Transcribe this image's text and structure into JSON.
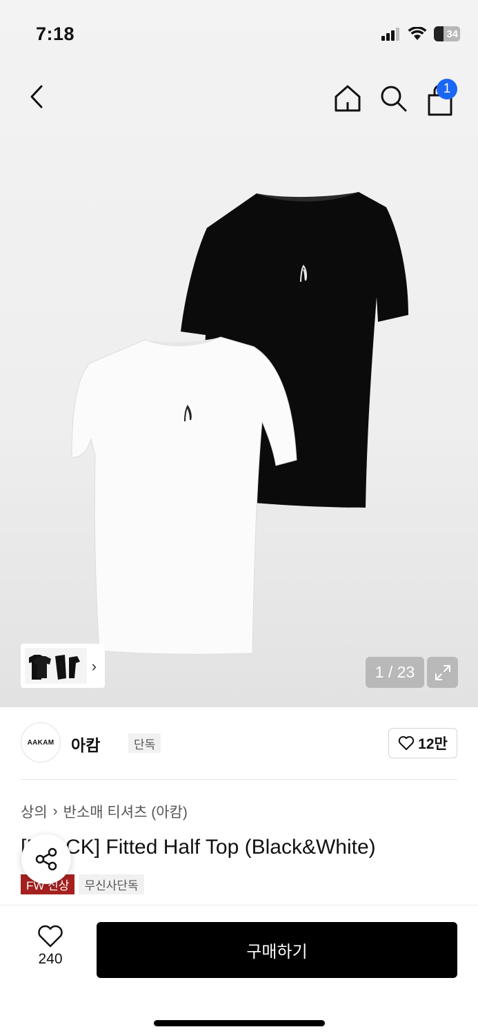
{
  "status_bar": {
    "time": "7:18",
    "battery": "34"
  },
  "nav": {
    "cart_count": "1"
  },
  "gallery": {
    "counter": "1 / 23"
  },
  "brand": {
    "logo_text": "AAKAM",
    "name": "아캄",
    "tag": "단독",
    "likes": "12만"
  },
  "breadcrumb": {
    "category": "상의",
    "subcategory": "반소매 티셔츠 (아캄)"
  },
  "product": {
    "title": "[BLACK] Fitted Half Top (Black&White)",
    "tags": [
      "FW 신상",
      "무신사단독"
    ]
  },
  "bottom_bar": {
    "wish_count": "240",
    "buy_label": "구매하기"
  },
  "colors": {
    "accent_blue": "#1b66f5",
    "tag_red": "#a5201f",
    "buy_button": "#000000"
  }
}
